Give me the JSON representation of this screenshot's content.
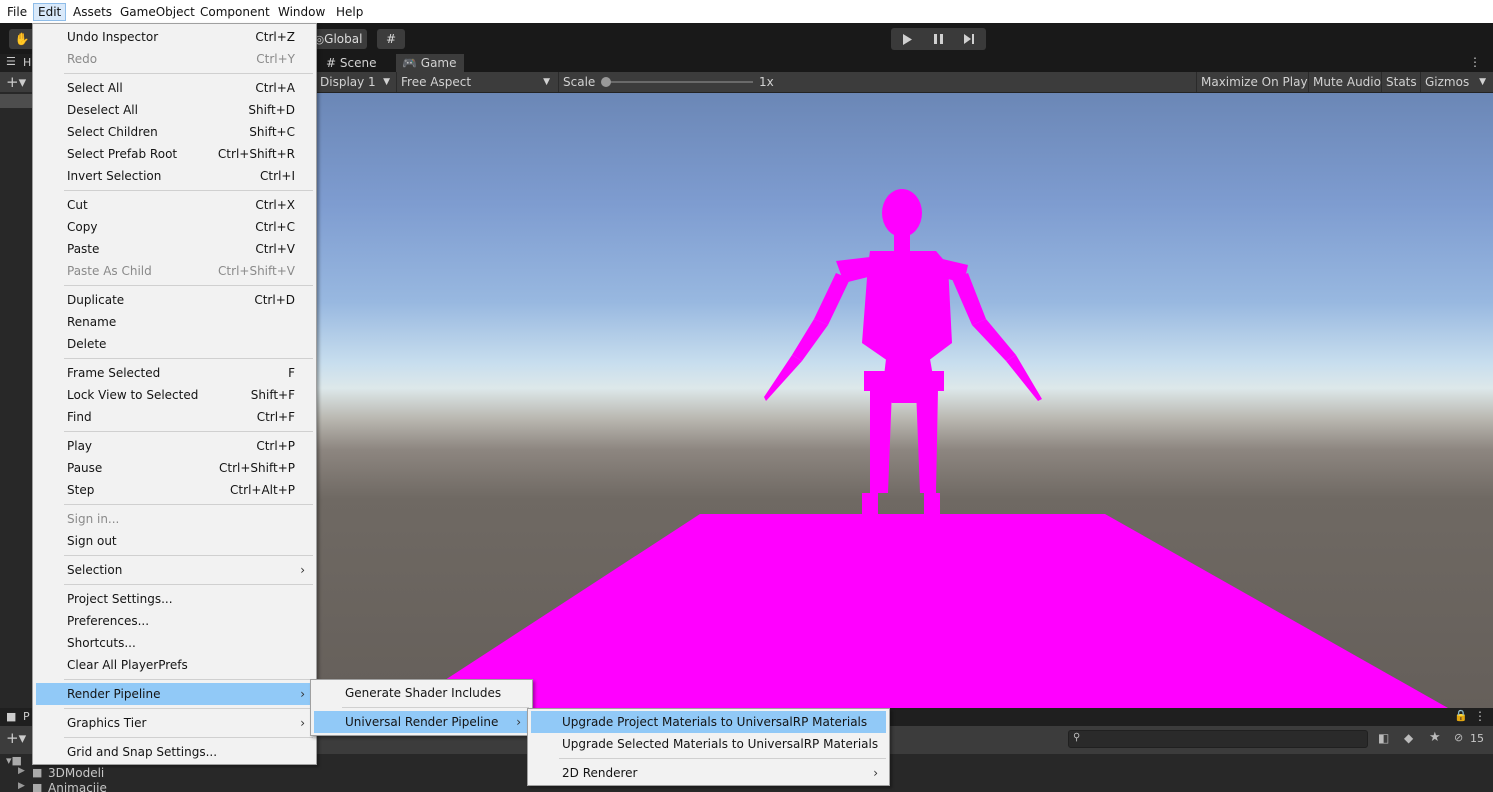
{
  "menubar": {
    "items": [
      "File",
      "Edit",
      "Assets",
      "GameObject",
      "Component",
      "Window",
      "Help"
    ]
  },
  "toolbar": {
    "global_label": "Global"
  },
  "left_panel": {
    "tab_letter": "H"
  },
  "game_view": {
    "tabs": [
      "Scene",
      "Game"
    ],
    "display": "Display 1",
    "aspect": "Free Aspect",
    "scale_label": "Scale",
    "scale_value": "1x",
    "maximize": "Maximize On Play",
    "mute": "Mute Audio",
    "stats": "Stats",
    "gizmos": "Gizmos",
    "colors": {
      "missing_material": "#ff00ff"
    }
  },
  "bottom_panel": {
    "tab_letter": "P",
    "folders": [
      "3DModeli",
      "Animacije"
    ],
    "hidden_count": "15"
  },
  "edit_menu": {
    "items": [
      {
        "label": "Undo Inspector",
        "shortcut": "Ctrl+Z"
      },
      {
        "label": "Redo",
        "shortcut": "Ctrl+Y",
        "disabled": true
      },
      {
        "label": "Select All",
        "shortcut": "Ctrl+A"
      },
      {
        "label": "Deselect All",
        "shortcut": "Shift+D"
      },
      {
        "label": "Select Children",
        "shortcut": "Shift+C"
      },
      {
        "label": "Select Prefab Root",
        "shortcut": "Ctrl+Shift+R"
      },
      {
        "label": "Invert Selection",
        "shortcut": "Ctrl+I"
      },
      {
        "label": "Cut",
        "shortcut": "Ctrl+X"
      },
      {
        "label": "Copy",
        "shortcut": "Ctrl+C"
      },
      {
        "label": "Paste",
        "shortcut": "Ctrl+V"
      },
      {
        "label": "Paste As Child",
        "shortcut": "Ctrl+Shift+V",
        "disabled": true
      },
      {
        "label": "Duplicate",
        "shortcut": "Ctrl+D"
      },
      {
        "label": "Rename",
        "shortcut": ""
      },
      {
        "label": "Delete",
        "shortcut": ""
      },
      {
        "label": "Frame Selected",
        "shortcut": "F"
      },
      {
        "label": "Lock View to Selected",
        "shortcut": "Shift+F"
      },
      {
        "label": "Find",
        "shortcut": "Ctrl+F"
      },
      {
        "label": "Play",
        "shortcut": "Ctrl+P"
      },
      {
        "label": "Pause",
        "shortcut": "Ctrl+Shift+P"
      },
      {
        "label": "Step",
        "shortcut": "Ctrl+Alt+P"
      },
      {
        "label": "Sign in...",
        "shortcut": "",
        "disabled": true
      },
      {
        "label": "Sign out",
        "shortcut": ""
      },
      {
        "label": "Selection",
        "shortcut": "",
        "submenu": true
      },
      {
        "label": "Project Settings...",
        "shortcut": ""
      },
      {
        "label": "Preferences...",
        "shortcut": ""
      },
      {
        "label": "Shortcuts...",
        "shortcut": ""
      },
      {
        "label": "Clear All PlayerPrefs",
        "shortcut": ""
      },
      {
        "label": "Render Pipeline",
        "shortcut": "",
        "submenu": true,
        "highlighted": true
      },
      {
        "label": "Graphics Tier",
        "shortcut": "",
        "submenu": true
      },
      {
        "label": "Grid and Snap Settings...",
        "shortcut": ""
      }
    ]
  },
  "render_pipeline_menu": {
    "items": [
      {
        "label": "Generate Shader Includes"
      },
      {
        "label": "Universal Render Pipeline",
        "submenu": true,
        "highlighted": true
      }
    ]
  },
  "urp_menu": {
    "items": [
      {
        "label": "Upgrade Project Materials to UniversalRP Materials",
        "highlighted": true
      },
      {
        "label": "Upgrade Selected Materials to UniversalRP Materials"
      },
      {
        "label": "2D Renderer",
        "submenu": true
      }
    ]
  }
}
